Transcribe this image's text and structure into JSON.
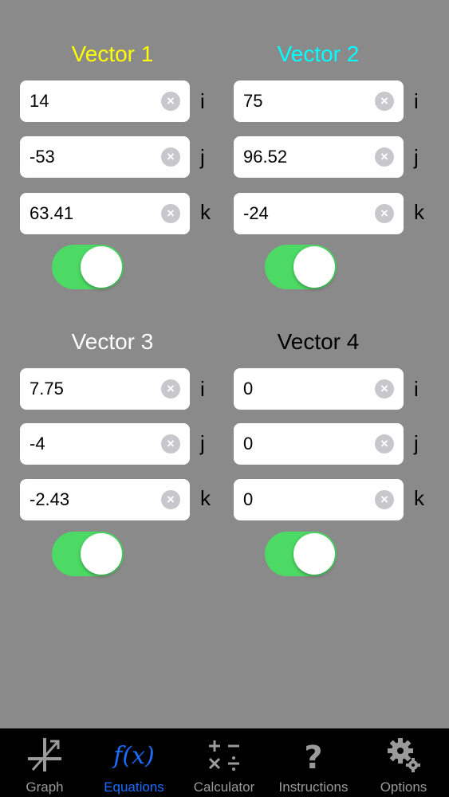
{
  "vectors": [
    {
      "title": "Vector 1",
      "title_color": "#ffff00",
      "i": "14",
      "j": "-53",
      "k": "63.41",
      "enabled": true
    },
    {
      "title": "Vector 2",
      "title_color": "#00ffff",
      "i": "75",
      "j": "96.52",
      "k": "-24",
      "enabled": true
    },
    {
      "title": "Vector 3",
      "title_color": "#ffffff",
      "i": "7.75",
      "j": "-4",
      "k": "-2.43",
      "enabled": true
    },
    {
      "title": "Vector 4",
      "title_color": "#000000",
      "i": "0",
      "j": "0",
      "k": "0",
      "enabled": true
    }
  ],
  "units": {
    "i": "i",
    "j": "j",
    "k": "k"
  },
  "tabs": [
    {
      "label": "Graph",
      "icon": "graph-icon",
      "active": false
    },
    {
      "label": "Equations",
      "icon": "function-icon",
      "active": true
    },
    {
      "label": "Calculator",
      "icon": "calculator-icon",
      "active": false
    },
    {
      "label": "Instructions",
      "icon": "question-icon",
      "active": false
    },
    {
      "label": "Options",
      "icon": "gear-icon",
      "active": false
    }
  ],
  "colors": {
    "background": "#8a8a8a",
    "toggle_on": "#4cd964",
    "tab_active": "#1a6dff",
    "tab_inactive": "#9a9a9a"
  }
}
